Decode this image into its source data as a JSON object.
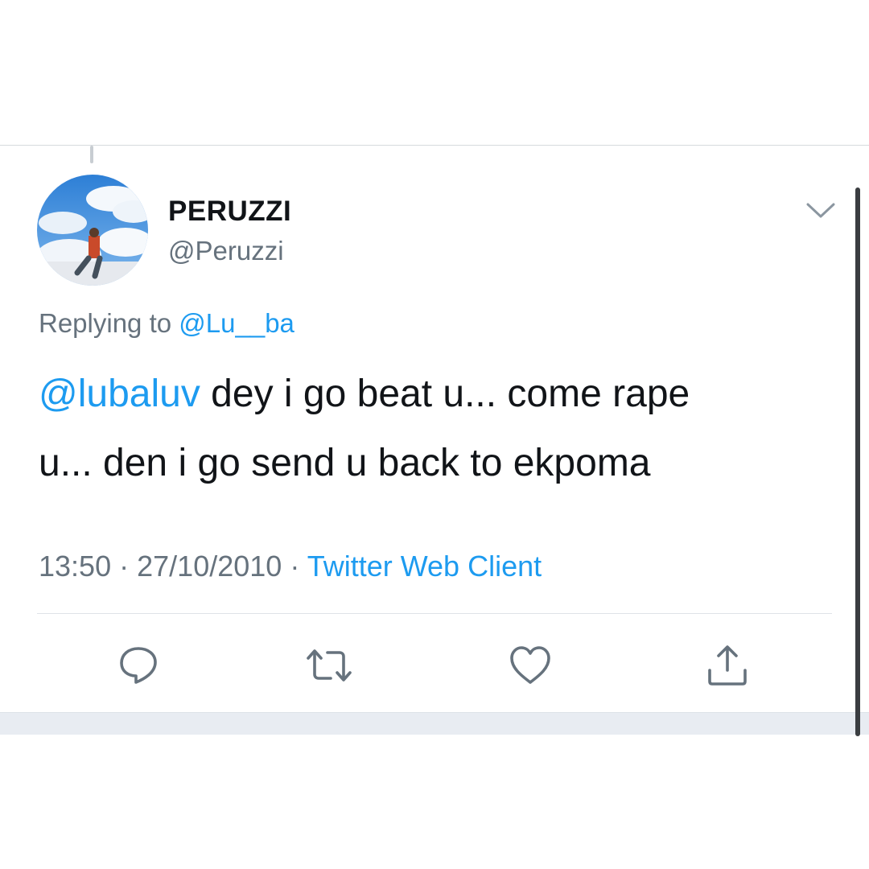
{
  "tweet": {
    "display_name": "PERUZZI",
    "handle": "@Peruzzi",
    "replying_prefix": "Replying to",
    "replying_to": "@Lu__ba",
    "text_mention": "@lubaluv",
    "text_line1": " dey i go beat u... come rape",
    "text_line2": "u... den i go send u back to ekpoma",
    "time": "13:50",
    "separator": "·",
    "date": "27/10/2010",
    "source": "Twitter Web Client"
  },
  "actions": {
    "icons": [
      "reply-icon",
      "retweet-icon",
      "like-icon",
      "share-icon"
    ]
  },
  "colors": {
    "link_blue": "#1d9bf0",
    "text_primary": "#111418",
    "text_secondary": "#66727d"
  }
}
